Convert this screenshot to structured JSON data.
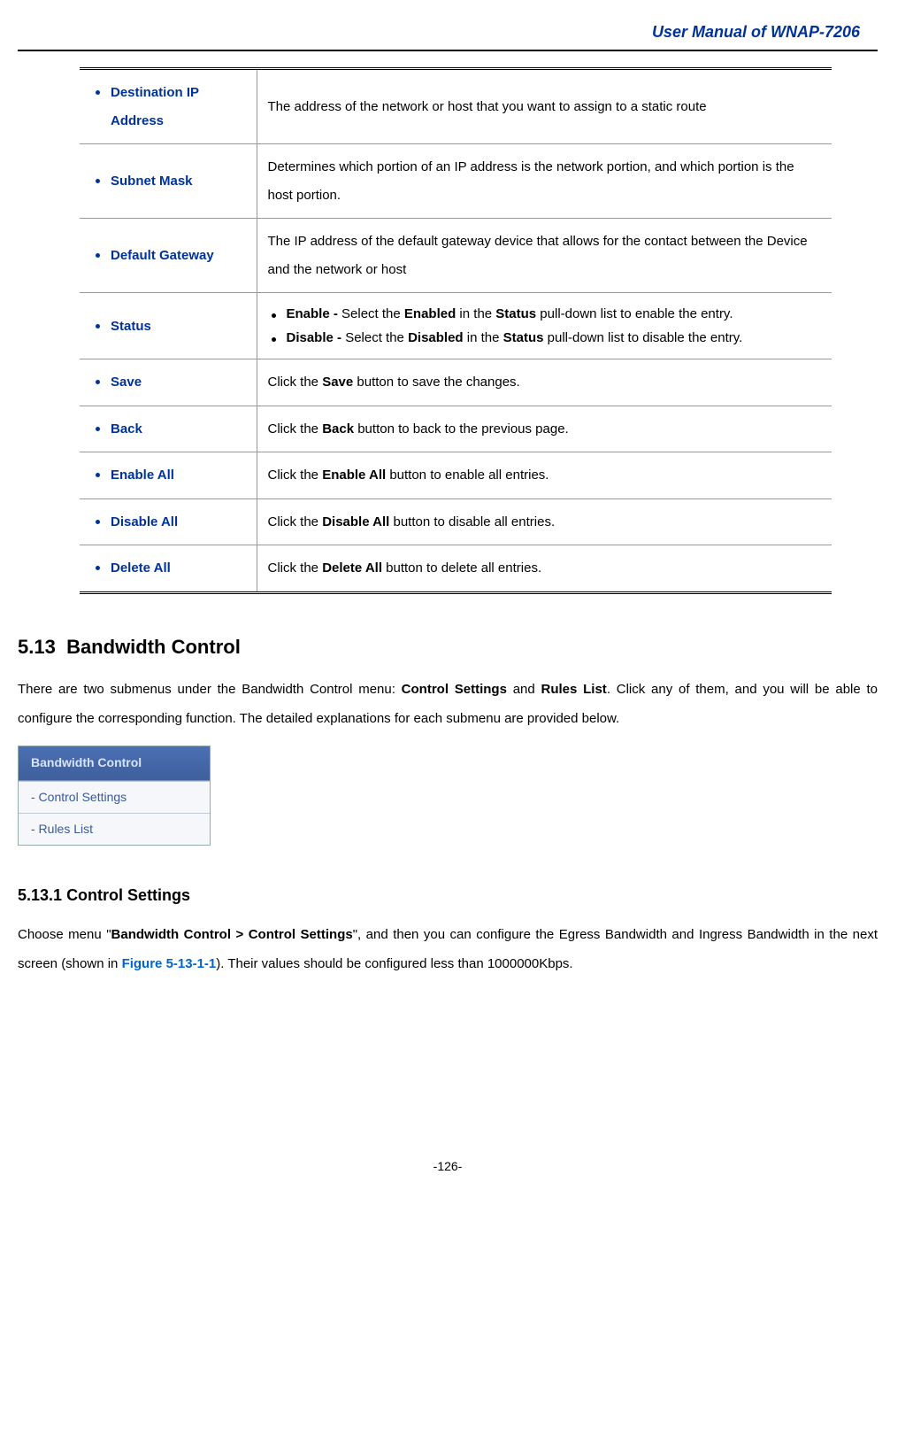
{
  "header": {
    "title": "User Manual of WNAP-7206"
  },
  "table": {
    "rows": [
      {
        "label": "Destination IP Address",
        "desc_plain": "The address of the network or host that you want to assign to a static route"
      },
      {
        "label": "Subnet Mask",
        "desc_plain": "Determines which portion of an IP address is the network portion, and which portion is the host portion."
      },
      {
        "label": "Default Gateway",
        "desc_plain": "The IP address of the default gateway device that allows for the contact between the Device and the network or host"
      },
      {
        "label": "Status",
        "sub": [
          {
            "prefix": "Enable - ",
            "mid1": "Select the ",
            "b1": "Enabled",
            "mid2": " in the ",
            "b2": "Status",
            "tail": " pull-down list to enable the entry."
          },
          {
            "prefix": "Disable - ",
            "mid1": "Select the ",
            "b1": "Disabled",
            "mid2": " in the ",
            "b2": "Status",
            "tail": " pull-down list to disable the entry."
          }
        ]
      },
      {
        "label": "Save",
        "desc_pre": "Click the ",
        "desc_b": "Save",
        "desc_post": " button to save the changes."
      },
      {
        "label": "Back",
        "desc_pre": "Click the ",
        "desc_b": "Back",
        "desc_post": " button to back to the previous page."
      },
      {
        "label": "Enable All",
        "desc_pre": "Click the ",
        "desc_b": "Enable All",
        "desc_post": " button to enable all entries."
      },
      {
        "label": "Disable All",
        "desc_pre": "Click the ",
        "desc_b": "Disable All",
        "desc_post": " button to disable all entries."
      },
      {
        "label": "Delete All",
        "desc_pre": "Click the ",
        "desc_b": "Delete All",
        "desc_post": " button to delete all entries."
      }
    ]
  },
  "section": {
    "number": "5.13",
    "title": "Bandwidth Control",
    "intro_pre": "There are two submenus under the Bandwidth Control menu: ",
    "intro_b1": "Control Settings",
    "intro_mid": " and ",
    "intro_b2": "Rules List",
    "intro_post": ". Click any of them, and you will be able to configure the corresponding function. The detailed explanations for each submenu are provided below."
  },
  "nav": {
    "head": "Bandwidth Control",
    "items": [
      "- Control Settings",
      "- Rules List"
    ]
  },
  "subsection": {
    "number": "5.13.1",
    "title": "Control Settings",
    "p_pre": "Choose menu \"",
    "p_b": "Bandwidth Control > Control Settings",
    "p_mid": "\", and then you can configure the Egress Bandwidth and Ingress Bandwidth in the next screen (shown in ",
    "p_figref": "Figure 5-13-1-1",
    "p_post": "). Their values should be configured less than 1000000Kbps."
  },
  "footer": {
    "page": "-126-"
  }
}
